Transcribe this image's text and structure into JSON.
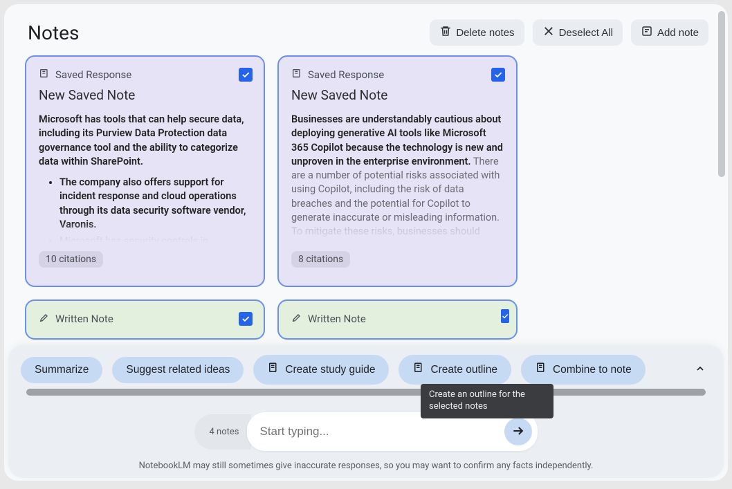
{
  "header": {
    "title": "Notes",
    "delete_label": "Delete notes",
    "deselect_label": "Deselect All",
    "add_label": "Add note"
  },
  "notes": [
    {
      "type_label": "Saved Response",
      "title": "New Saved Note",
      "body_bold": "Microsoft has tools that can help secure data, including its Purview Data Protection data governance tool and the ability to categorize data within SharePoint.",
      "bullet1": "The company also offers support for incident response and cloud operations through its data security software vendor, Varonis.",
      "bullet2": "Microsoft has security controls in",
      "citations": "10 citations"
    },
    {
      "type_label": "Saved Response",
      "title": "New Saved Note",
      "body_bold": "Businesses are understandably cautious about deploying generative AI tools like Microsoft 365 Copilot because the technology is new and unproven in the enterprise environment.",
      "body_rest": " There are a number of potential risks associated with using Copilot, including the risk of data breaches and the potential for Copilot to generate inaccurate or misleading information.",
      "body_cutoff": "To mitigate these risks, businesses should",
      "citations": "8 citations"
    },
    {
      "type_label": "Written Note"
    },
    {
      "type_label": "Written Note"
    }
  ],
  "chips": {
    "summarize": "Summarize",
    "suggest": "Suggest related ideas",
    "study_guide": "Create study guide",
    "outline": "Create outline",
    "combine": "Combine to note"
  },
  "tooltip": "Create an outline for the selected notes",
  "input": {
    "count": "4 notes",
    "placeholder": "Start typing..."
  },
  "disclaimer": "NotebookLM may still sometimes give inaccurate responses, so you may want to confirm any facts independently."
}
